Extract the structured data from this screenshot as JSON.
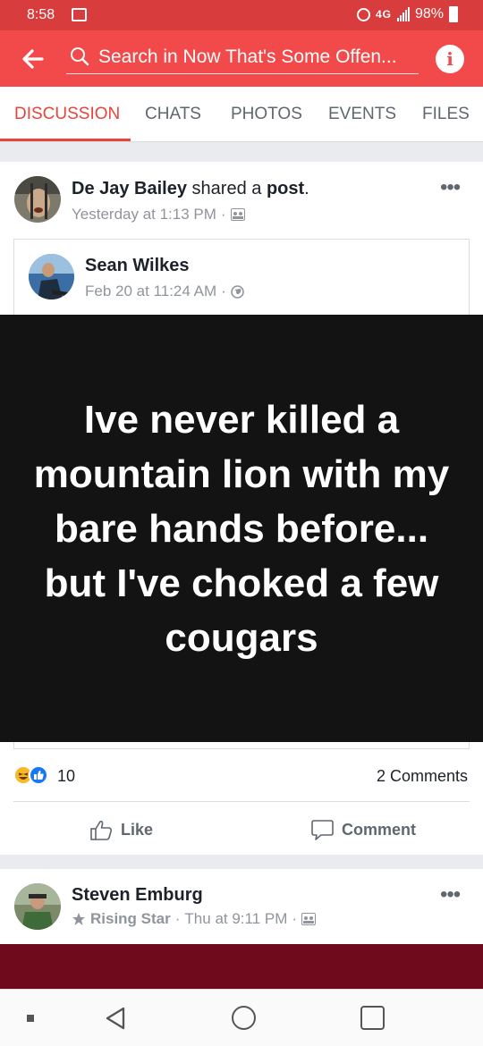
{
  "status_bar": {
    "time": "8:58",
    "network": "4G",
    "battery": "98%"
  },
  "search": {
    "text": "Search in Now That's Some Offen..."
  },
  "tabs": [
    {
      "label": "DISCUSSION"
    },
    {
      "label": "CHATS"
    },
    {
      "label": "PHOTOS"
    },
    {
      "label": "EVENTS"
    },
    {
      "label": "FILES"
    }
  ],
  "post": {
    "author": "De Jay Bailey",
    "shared_text": "shared a",
    "shared_object": "post",
    "time": "Yesterday at 1:13 PM",
    "more": "•••",
    "original": {
      "author": "Sean Wilkes",
      "time": "Feb 20 at 11:24 AM",
      "image_text": "Ive never killed a mountain lion with my bare hands before... but I've choked a few cougars"
    },
    "reaction_count": "10",
    "comments": "2 Comments",
    "like_label": "Like",
    "comment_label": "Comment"
  },
  "next_post": {
    "author": "Steven Emburg",
    "badge": "Rising Star",
    "time": "Thu at 9:11 PM",
    "more": "•••"
  },
  "colors": {
    "brand_red": "#f24a4a",
    "status_red": "#d93c3c",
    "tab_active": "#e9443b",
    "next_post_banner": "#6e0a1c"
  }
}
